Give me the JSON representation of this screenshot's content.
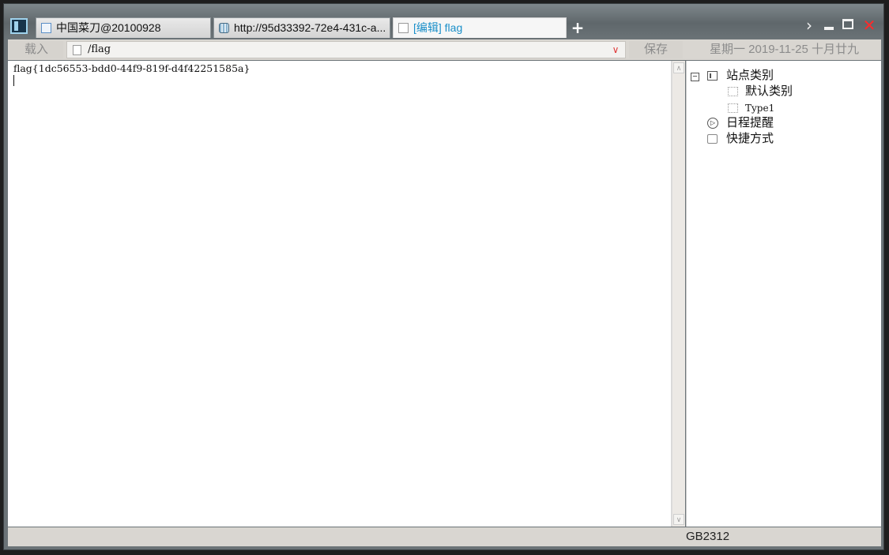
{
  "tabs": [
    {
      "label": "中国菜刀@20100928",
      "icon": "window-icon"
    },
    {
      "label": "http://95d33392-72e4-431c-a...",
      "icon": "database-icon"
    },
    {
      "label": "[编辑] flag",
      "icon": "file-icon",
      "active": true
    }
  ],
  "window_controls": {
    "new_tab": "+",
    "next": "›",
    "close": "✕"
  },
  "toolbar": {
    "load_label": "载入",
    "path_value": "/flag",
    "save_label": "保存",
    "date_text": "星期一 2019-11-25 十月廿九",
    "dropdown_glyph": "∨"
  },
  "editor": {
    "content": "flag{1dc56553-bdd0-44f9-819f-d4f42251585a}"
  },
  "scrollbar": {
    "up": "∧",
    "down": "∨"
  },
  "tree": {
    "expander": "−",
    "root_label": "站点类别",
    "children": [
      {
        "label": "默认类别"
      },
      {
        "label": "Type1"
      }
    ],
    "schedule_label": "日程提醒",
    "schedule_glyph": "▷",
    "shortcut_label": "快捷方式"
  },
  "status": {
    "encoding": "GB2312"
  },
  "colors": {
    "active_tab_text": "#1a8fc9",
    "close_button": "#ff2a2a",
    "titlebar": "#6b7377"
  }
}
